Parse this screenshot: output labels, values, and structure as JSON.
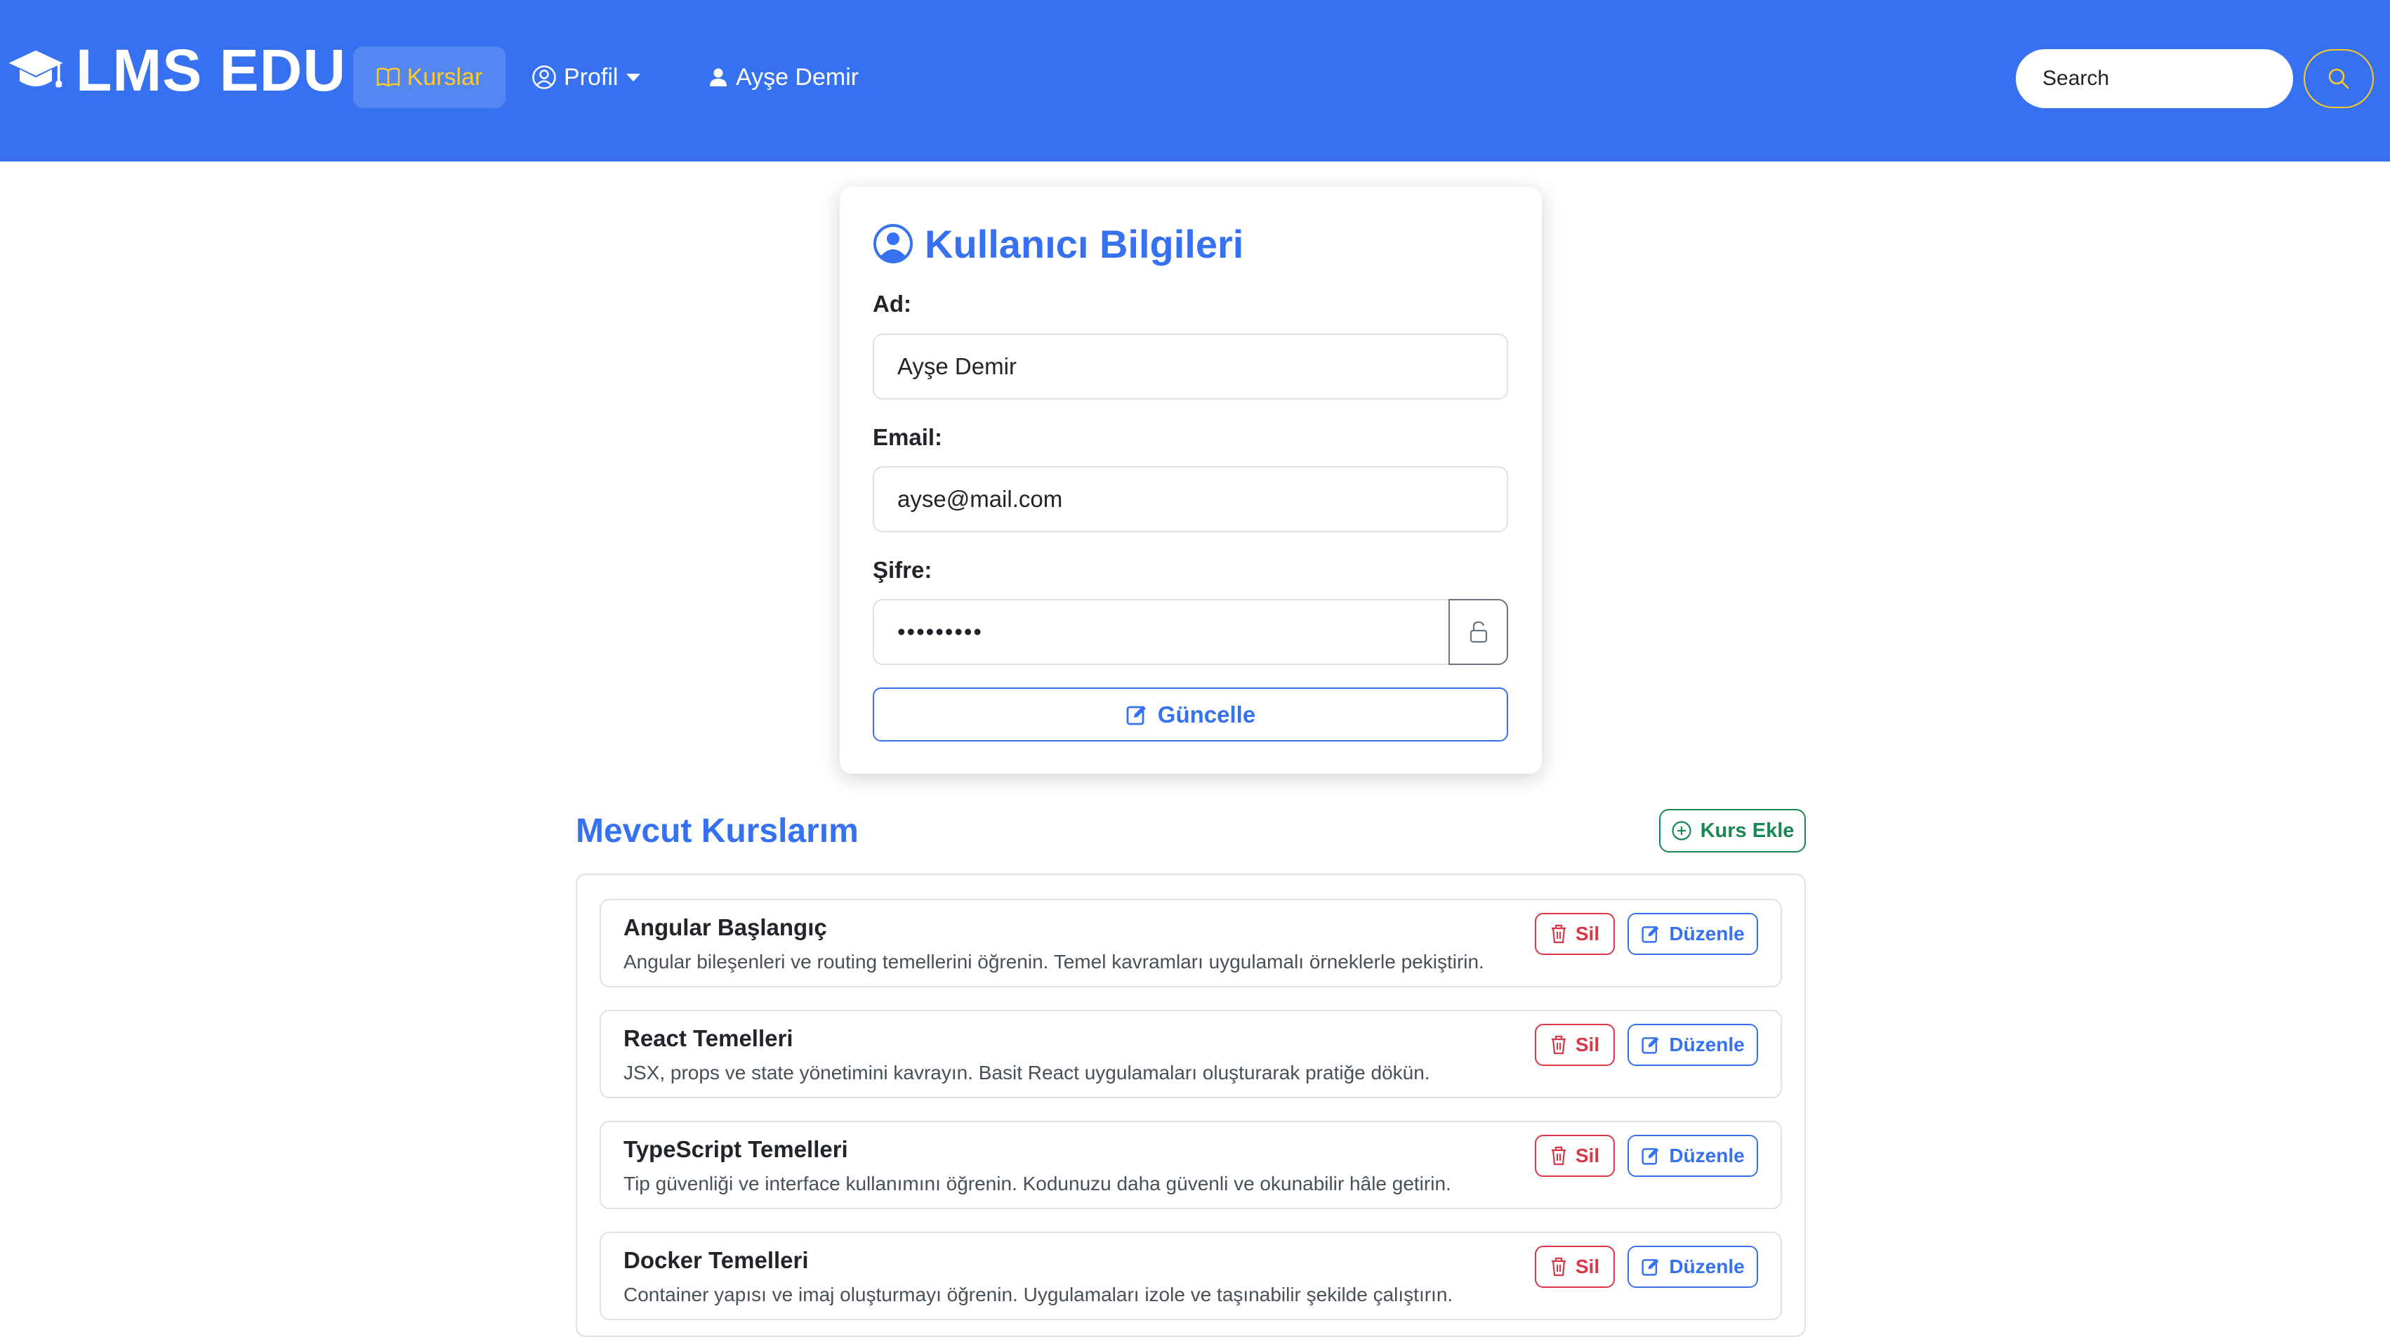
{
  "navbar": {
    "brand": "LMS EDU",
    "links": {
      "kurslar": "Kurslar",
      "profil": "Profil",
      "user": "Ayşe Demir"
    },
    "search": {
      "placeholder": "Search"
    },
    "colors": {
      "background": "#3571f1",
      "active": "#ffc928"
    }
  },
  "profile_card": {
    "title": "Kullanıcı Bilgileri",
    "name_label": "Ad:",
    "name_value": "Ayşe Demir",
    "email_label": "Email:",
    "email_value": "ayse@mail.com",
    "password_label": "Şifre:",
    "password_masked": "•••••••••",
    "update_button": "Güncelle"
  },
  "courses": {
    "title": "Mevcut Kurslarım",
    "add_button": "Kurs Ekle",
    "delete_label": "Sil",
    "edit_label": "Düzenle",
    "items": [
      {
        "title": "Angular Başlangıç",
        "description": "Angular bileşenleri ve routing temellerini öğrenin. Temel kavramları uygulamalı örneklerle pekiştirin."
      },
      {
        "title": "React Temelleri",
        "description": "JSX, props ve state yönetimini kavrayın. Basit React uygulamaları oluşturarak pratiğe dökün."
      },
      {
        "title": "TypeScript Temelleri",
        "description": "Tip güvenliği ve interface kullanımını öğrenin. Kodunuzu daha güvenli ve okunabilir hâle getirin."
      },
      {
        "title": "Docker Temelleri",
        "description": "Container yapısı ve imaj oluşturmayı öğrenin. Uygulamaları izole ve taşınabilir şekilde çalıştırın."
      }
    ]
  }
}
